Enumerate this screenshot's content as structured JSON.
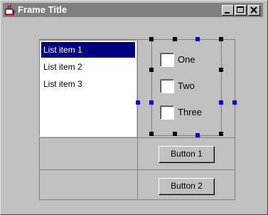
{
  "window": {
    "title": "Frame Title"
  },
  "title_buttons": {
    "minimize": "minimize-icon",
    "maximize": "maximize-icon",
    "close": "close-icon"
  },
  "list": {
    "items": [
      "List item 1",
      "List item 2",
      "List item 3"
    ],
    "selected_index": 0
  },
  "checkboxes": [
    {
      "label": "One",
      "checked": false
    },
    {
      "label": "Two",
      "checked": false
    },
    {
      "label": "Three",
      "checked": false
    }
  ],
  "buttons": {
    "button1": "Button 1",
    "button2": "Button 2"
  },
  "colors": {
    "selection": "#000080",
    "handle_black": "#000000",
    "handle_blue": "#0000ff",
    "face": "#c0c0c0"
  }
}
